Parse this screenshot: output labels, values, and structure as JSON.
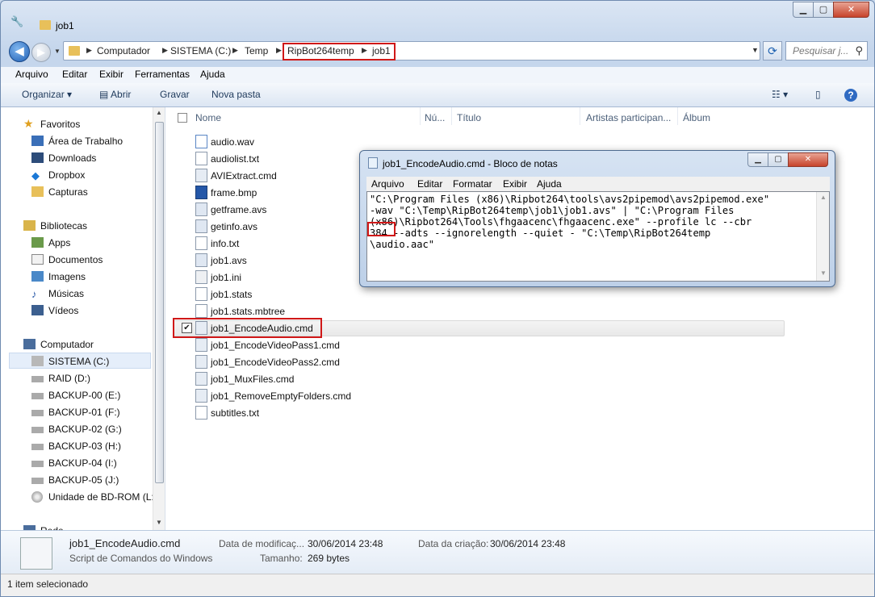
{
  "window": {
    "title": "job1"
  },
  "nav": {
    "address": [
      "Computador",
      "SISTEMA (C:)",
      "Temp",
      "RipBot264temp",
      "job1"
    ],
    "search_placeholder": "Pesquisar j..."
  },
  "menubar": [
    "Arquivo",
    "Editar",
    "Exibir",
    "Ferramentas",
    "Ajuda"
  ],
  "toolbar": {
    "organize": "Organizar",
    "open": "Abrir",
    "burn": "Gravar",
    "new_folder": "Nova pasta"
  },
  "sidebar": {
    "favorites_header": "Favoritos",
    "favorites": [
      "Área de Trabalho",
      "Downloads",
      "Dropbox",
      "Capturas"
    ],
    "libraries_header": "Bibliotecas",
    "libraries": [
      "Apps",
      "Documentos",
      "Imagens",
      "Músicas",
      "Vídeos"
    ],
    "computer_header": "Computador",
    "drives": [
      "SISTEMA (C:)",
      "RAID (D:)",
      "BACKUP-00 (E:)",
      "BACKUP-01 (F:)",
      "BACKUP-02 (G:)",
      "BACKUP-03 (H:)",
      "BACKUP-04 (I:)",
      "BACKUP-05 (J:)",
      "Unidade de BD-ROM (L:)"
    ],
    "network_header": "Rede"
  },
  "columns": [
    "Nome",
    "Nú...",
    "Título",
    "Artistas participan...",
    "Álbum"
  ],
  "files": [
    "audio.wav",
    "audiolist.txt",
    "AVIExtract.cmd",
    "frame.bmp",
    "getframe.avs",
    "getinfo.avs",
    "info.txt",
    "job1.avs",
    "job1.ini",
    "job1.stats",
    "job1.stats.mbtree",
    "job1_EncodeAudio.cmd",
    "job1_EncodeVideoPass1.cmd",
    "job1_EncodeVideoPass2.cmd",
    "job1_MuxFiles.cmd",
    "job1_RemoveEmptyFolders.cmd",
    "subtitles.txt"
  ],
  "details": {
    "filename": "job1_EncodeAudio.cmd",
    "filetype": "Script de Comandos do Windows",
    "modified_label": "Data de modificaç...",
    "modified_value": "30/06/2014 23:48",
    "size_label": "Tamanho:",
    "size_value": "269 bytes",
    "created_label": "Data da criação:",
    "created_value": "30/06/2014 23:48"
  },
  "status": "1 item selecionado",
  "notepad": {
    "title": "job1_EncodeAudio.cmd - Bloco de notas",
    "menu": [
      "Arquivo",
      "Editar",
      "Formatar",
      "Exibir",
      "Ajuda"
    ],
    "content": "\"C:\\Program Files (x86)\\Ripbot264\\tools\\avs2pipemod\\avs2pipemod.exe\"\n-wav \"C:\\Temp\\RipBot264temp\\job1\\job1.avs\" | \"C:\\Program Files\n(x86)\\Ripbot264\\Tools\\fhgaacenc\\fhgaacenc.exe\" --profile lc --cbr\n384 --adts --ignorelength --quiet - \"C:\\Temp\\RipBot264temp\n\\audio.aac\""
  }
}
